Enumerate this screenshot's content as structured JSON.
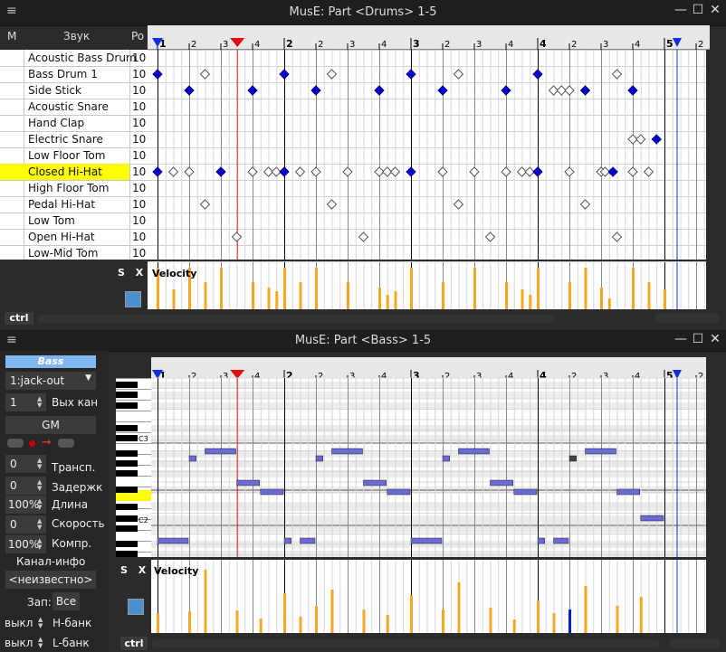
{
  "drums_window": {
    "title": "MusE: Part <Drums> 1-5",
    "menu_icon": "≡",
    "header": {
      "mute": "M",
      "sound": "Звук",
      "port": "Po"
    },
    "instruments": [
      {
        "name": "Acoustic Bass Drum",
        "vol": "10"
      },
      {
        "name": "Bass Drum 1",
        "vol": "10"
      },
      {
        "name": "Side Stick",
        "vol": "10"
      },
      {
        "name": "Acoustic Snare",
        "vol": "10"
      },
      {
        "name": "Hand Clap",
        "vol": "10"
      },
      {
        "name": "Electric Snare",
        "vol": "10"
      },
      {
        "name": "Low Floor Tom",
        "vol": "10"
      },
      {
        "name": "Closed Hi-Hat",
        "vol": "10"
      },
      {
        "name": "High Floor Tom",
        "vol": "10"
      },
      {
        "name": "Pedal Hi-Hat",
        "vol": "10"
      },
      {
        "name": "Low Tom",
        "vol": "10"
      },
      {
        "name": "Open Hi-Hat",
        "vol": "10"
      },
      {
        "name": "Low-Mid Tom",
        "vol": "10"
      }
    ],
    "selected_index": 7,
    "ruler": [
      "1",
      "2",
      "3",
      "4",
      "2",
      "2",
      "3",
      "4",
      "3",
      "2",
      "3",
      "4",
      "4",
      "2",
      "3",
      "4",
      "5",
      "2"
    ],
    "s_label": "S",
    "x_label": "X",
    "velocity_label": "Velocity",
    "ctrl_label": "ctrl"
  },
  "bass_window": {
    "title": "MusE: Part <Bass> 1-5",
    "menu_icon": "≡",
    "track_name": "Bass",
    "output_port": "1:jack-out",
    "out_channel_value": "1",
    "out_channel_label": "Вых кан",
    "gm_label": "GM",
    "transpose_value": "0",
    "transpose_label": "Трансп.",
    "delay_value": "0",
    "delay_label": "Задержк",
    "length_value": "100%",
    "length_label": "Длина",
    "velocity_value": "0",
    "velocity_label_panel": "Скорость",
    "compression_value": "100%",
    "compression_label": "Компр.",
    "channel_info_label": "Канал-инфо",
    "unknown_label": "<неизвестно>",
    "rec_label": "Зап:",
    "all_label": "Все",
    "hbank_state": "выкл",
    "hbank_label": "H-банк",
    "lbank_state": "выкл",
    "lbank_label": "L-банк",
    "keyboard_labels": [
      "C3",
      "C2"
    ],
    "ruler": [
      "1",
      "2",
      "3",
      "4",
      "2",
      "2",
      "3",
      "4",
      "3",
      "2",
      "3",
      "4",
      "4",
      "2",
      "3",
      "4",
      "5",
      "2"
    ],
    "s_label": "S",
    "x_label": "X",
    "velocity_label": "Velocity",
    "ctrl_label": "ctrl"
  },
  "colors": {
    "selected_row": "#ffff00",
    "note_fill": "#0000cc",
    "velocity_bar": "#f5a623",
    "bass_note": "#6b6bd6",
    "playhead": "#e01010",
    "track_name_bg": "#7fb8f0"
  }
}
